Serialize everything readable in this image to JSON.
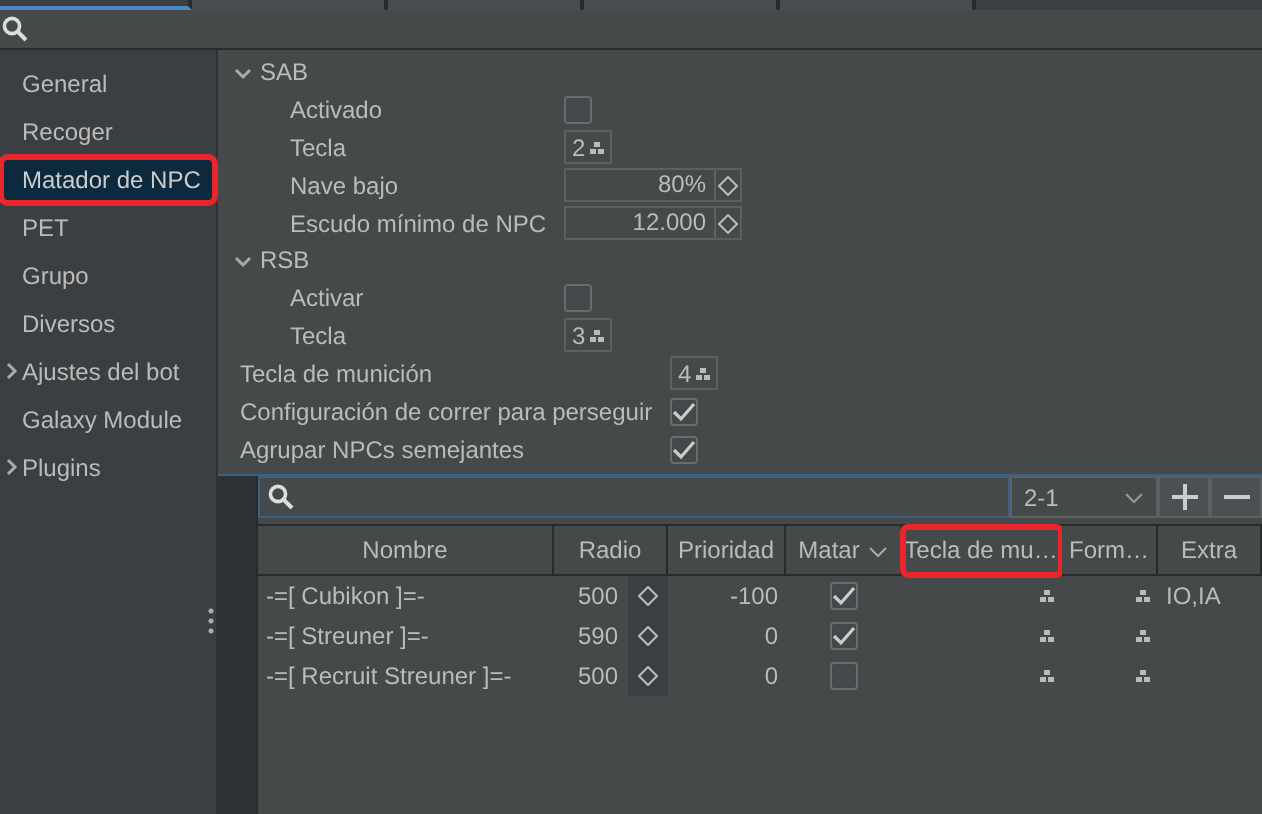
{
  "tabs": [
    {
      "selected": true
    },
    {
      "selected": false
    },
    {
      "selected": false
    },
    {
      "selected": false
    },
    {
      "selected": false
    }
  ],
  "sidebar": {
    "items": [
      {
        "label": "General",
        "selected": false,
        "expandable": false,
        "highlighted": false
      },
      {
        "label": "Recoger",
        "selected": false,
        "expandable": false,
        "highlighted": false
      },
      {
        "label": "Matador de NPC",
        "selected": true,
        "expandable": false,
        "highlighted": true
      },
      {
        "label": "PET",
        "selected": false,
        "expandable": false,
        "highlighted": false
      },
      {
        "label": "Grupo",
        "selected": false,
        "expandable": false,
        "highlighted": false
      },
      {
        "label": "Diversos",
        "selected": false,
        "expandable": false,
        "highlighted": false
      },
      {
        "label": "Ajustes del bot",
        "selected": false,
        "expandable": true,
        "highlighted": false
      },
      {
        "label": "Galaxy Module",
        "selected": false,
        "expandable": false,
        "highlighted": false
      },
      {
        "label": "Plugins",
        "selected": false,
        "expandable": true,
        "highlighted": false
      }
    ]
  },
  "settings": [
    {
      "kind": "section",
      "title": "SAB",
      "expanded": true,
      "items": [
        {
          "kind": "checkbox",
          "label": "Activado",
          "checked": false
        },
        {
          "kind": "key",
          "label": "Tecla",
          "value": "2"
        },
        {
          "kind": "number",
          "label": "Nave bajo",
          "value": "80%"
        },
        {
          "kind": "number",
          "label": "Escudo mínimo de NPC",
          "value": "12.000"
        }
      ]
    },
    {
      "kind": "section",
      "title": "RSB",
      "expanded": true,
      "items": [
        {
          "kind": "checkbox",
          "label": "Activar",
          "checked": false
        },
        {
          "kind": "key",
          "label": "Tecla",
          "value": "3"
        }
      ]
    },
    {
      "kind": "key",
      "label": "Tecla de munición",
      "value": "4"
    },
    {
      "kind": "checkbox",
      "label": "Configuración de correr para perseguir",
      "checked": true
    },
    {
      "kind": "checkbox",
      "label": "Agrupar NPCs semejantes",
      "checked": true
    }
  ],
  "table": {
    "map": "2-1",
    "columns": [
      {
        "label": "Nombre",
        "highlighted": false,
        "menu": false
      },
      {
        "label": "Radio",
        "highlighted": false,
        "menu": false
      },
      {
        "label": "Prioridad",
        "highlighted": false,
        "menu": false
      },
      {
        "label": "Matar",
        "highlighted": false,
        "menu": true
      },
      {
        "label": "Tecla de mu…",
        "highlighted": true,
        "menu": false
      },
      {
        "label": "Form…",
        "highlighted": false,
        "menu": false
      },
      {
        "label": "Extra",
        "highlighted": false,
        "menu": false
      }
    ],
    "rows": [
      {
        "name": "-=[ Cubikon ]=-",
        "radio": "500",
        "priority": "-100",
        "kill": true,
        "extra": "IO,IA"
      },
      {
        "name": "-=[ Streuner ]=-",
        "radio": "590",
        "priority": "0",
        "kill": true
      },
      {
        "name": "-=[ Recruit Streuner ]=-",
        "radio": "500",
        "priority": "0",
        "kill": false
      }
    ]
  }
}
